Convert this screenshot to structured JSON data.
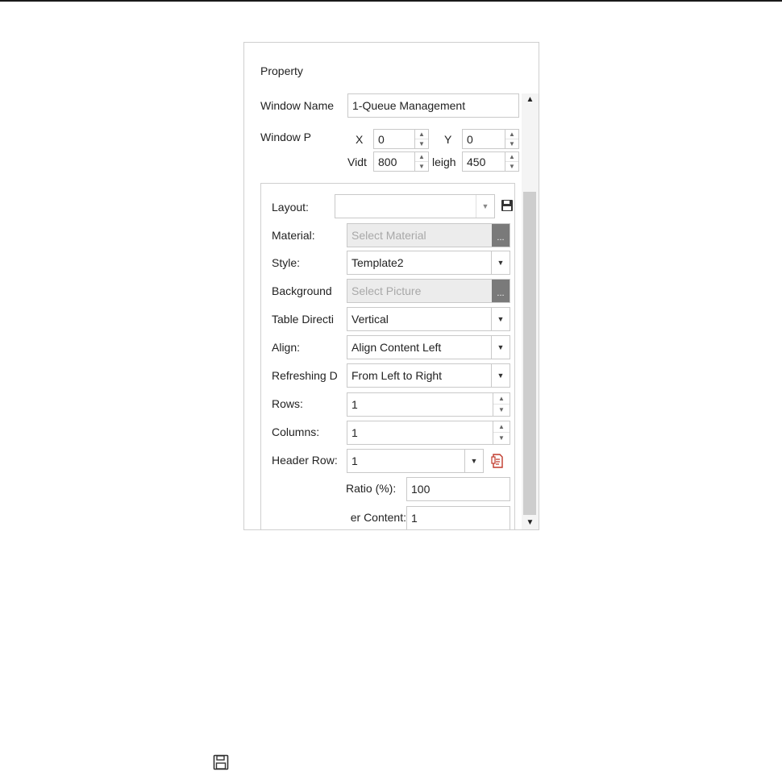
{
  "panel": {
    "title": "Property",
    "window_name": {
      "label": "Window Name",
      "value": "1-Queue Management"
    },
    "window_position": {
      "label": "Window P",
      "x_label": "X",
      "x_value": "0",
      "y_label": "Y",
      "y_value": "0",
      "width_label": "Vidt",
      "width_value": "800",
      "height_label": "leigh",
      "height_value": "450"
    },
    "layout": {
      "label": "Layout:",
      "value": ""
    },
    "material": {
      "label": "Material:",
      "placeholder": "Select Material",
      "browse": "..."
    },
    "style": {
      "label": "Style:",
      "value": "Template2"
    },
    "background": {
      "label": "Background",
      "placeholder": "Select Picture",
      "browse": "..."
    },
    "table_direction": {
      "label": "Table Directi",
      "value": "Vertical"
    },
    "align": {
      "label": "Align:",
      "value": "Align Content Left"
    },
    "refreshing_direction": {
      "label": "Refreshing D",
      "value": "From Left to Right"
    },
    "rows": {
      "label": "Rows:",
      "value": "1"
    },
    "columns": {
      "label": "Columns:",
      "value": "1"
    },
    "header_row": {
      "label": "Header Row:",
      "value": "1"
    },
    "ratio": {
      "label": "Ratio (%):",
      "value": "100"
    },
    "header_content": {
      "label": "er Content:",
      "value": "1"
    }
  },
  "icons": {
    "save": "floppy-disk",
    "header_row_edit": "document-edit",
    "scroll_up": "triangle-up",
    "scroll_down": "triangle-down"
  },
  "colors": {
    "edit_icon": "#c0392b",
    "ellipsis_button": "#7a7a7a"
  }
}
